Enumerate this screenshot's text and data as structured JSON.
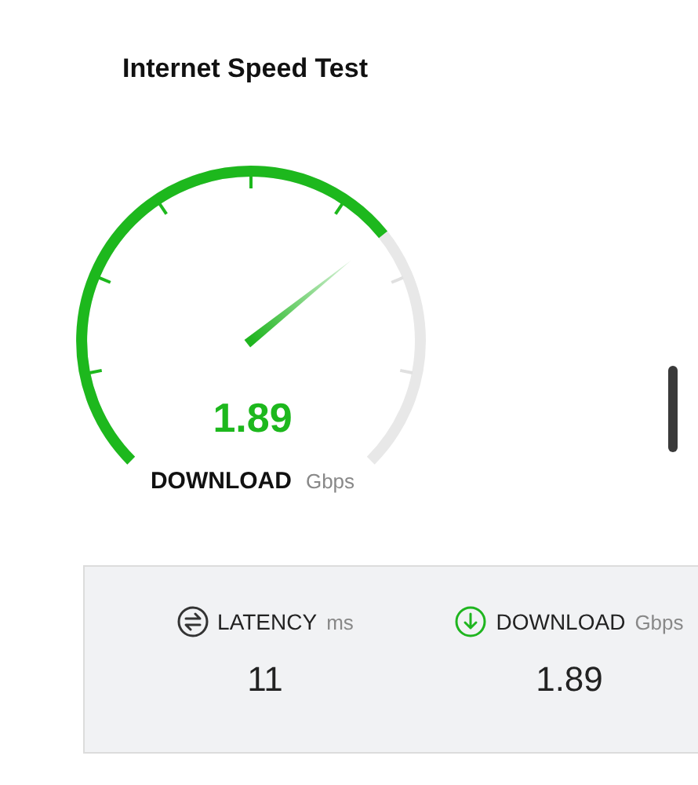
{
  "title": "Internet Speed Test",
  "gauge": {
    "value": "1.89",
    "label": "DOWNLOAD",
    "unit": "Gbps"
  },
  "stats": [
    {
      "kind": "latency",
      "label": "LATENCY",
      "unit": "ms",
      "value": "11"
    },
    {
      "kind": "download",
      "label": "DOWNLOAD",
      "unit": "Gbps",
      "value": "1.89"
    }
  ]
}
